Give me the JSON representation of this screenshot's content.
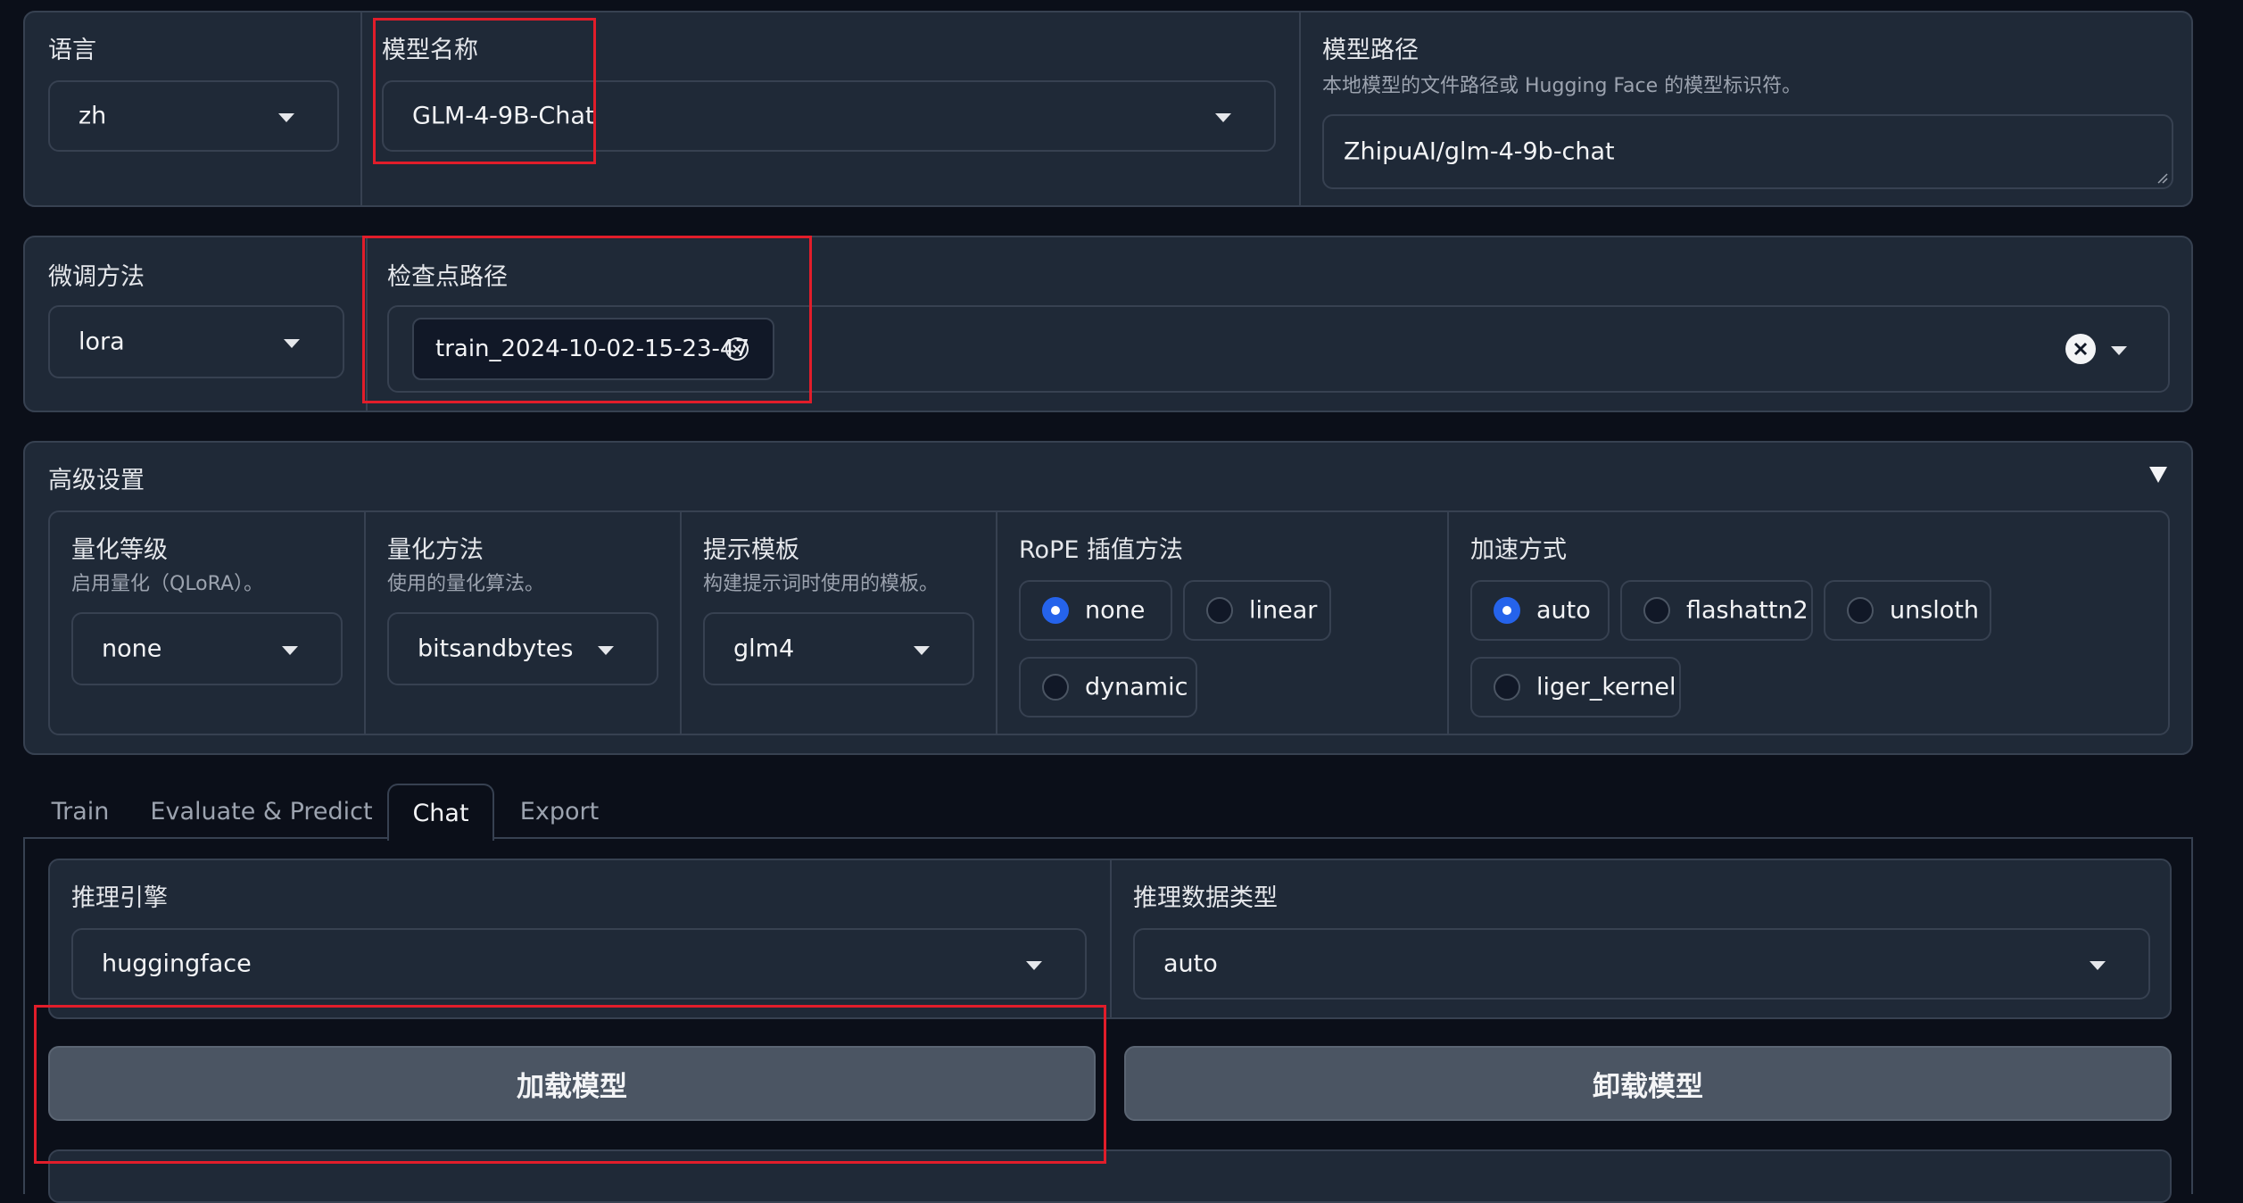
{
  "top": {
    "lang_label": "语言",
    "lang_value": "zh",
    "model_name_label": "模型名称",
    "model_name_value": "GLM-4-9B-Chat",
    "model_path_label": "模型路径",
    "model_path_info": "本地模型的文件路径或 Hugging Face 的模型标识符。",
    "model_path_value": "ZhipuAI/glm-4-9b-chat"
  },
  "adapter": {
    "finetune_label": "微调方法",
    "finetune_value": "lora",
    "checkpoint_label": "检查点路径",
    "checkpoint_tag": "train_2024-10-02-15-23-47"
  },
  "advanced": {
    "title": "高级设置",
    "quant_bit_label": "量化等级",
    "quant_bit_info": "启用量化（QLoRA）。",
    "quant_bit_value": "none",
    "quant_method_label": "量化方法",
    "quant_method_info": "使用的量化算法。",
    "quant_method_value": "bitsandbytes",
    "template_label": "提示模板",
    "template_info": "构建提示词时使用的模板。",
    "template_value": "glm4",
    "rope_label": "RoPE 插值方法",
    "rope_options": [
      "none",
      "linear",
      "dynamic"
    ],
    "rope_selected": "none",
    "booster_label": "加速方式",
    "booster_options": [
      "auto",
      "flashattn2",
      "unsloth",
      "liger_kernel"
    ],
    "booster_selected": "auto"
  },
  "tabs": [
    "Train",
    "Evaluate & Predict",
    "Chat",
    "Export"
  ],
  "active_tab": "Chat",
  "chat": {
    "infer_backend_label": "推理引擎",
    "infer_backend_value": "huggingface",
    "infer_dtype_label": "推理数据类型",
    "infer_dtype_value": "auto",
    "load_button": "加载模型",
    "unload_button": "卸载模型"
  },
  "colors": {
    "background": "#0b0f19",
    "panel": "#1f2937",
    "border": "#374151",
    "accent": "#2563eb",
    "highlight": "#e11d2a"
  }
}
